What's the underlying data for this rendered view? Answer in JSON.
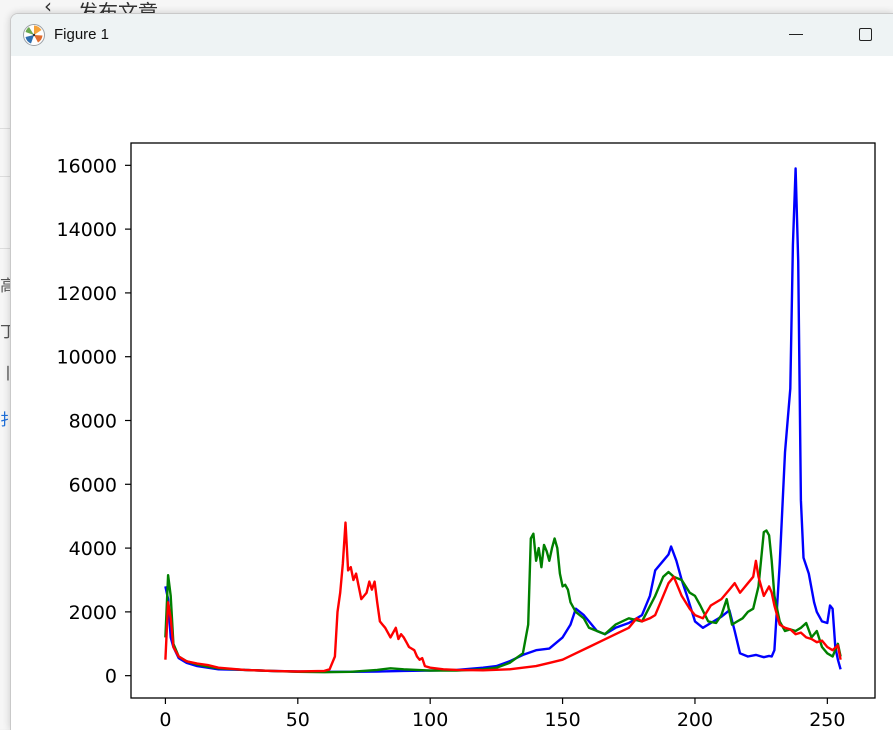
{
  "background": {
    "header_title": "发布文章",
    "back_glyph": "‹",
    "fragments": [
      "高",
      "丁",
      "丨",
      "扌"
    ]
  },
  "window": {
    "title": "Figure 1",
    "icon": "matplotlib-icon",
    "controls": {
      "minimize": "minimize-icon",
      "maximize": "maximize-icon"
    }
  },
  "chart_data": {
    "type": "line",
    "title": "",
    "xlabel": "",
    "ylabel": "",
    "xlim": [
      -13,
      268
    ],
    "ylim": [
      -700,
      16700
    ],
    "xticks": [
      0,
      50,
      100,
      150,
      200,
      250
    ],
    "yticks": [
      0,
      2000,
      4000,
      6000,
      8000,
      10000,
      12000,
      14000,
      16000
    ],
    "grid": false,
    "legend": "none",
    "series": [
      {
        "color": "#0000ff",
        "x": [
          0,
          1,
          2,
          3,
          5,
          8,
          12,
          16,
          20,
          30,
          40,
          50,
          60,
          70,
          80,
          90,
          100,
          110,
          120,
          125,
          130,
          135,
          140,
          145,
          150,
          153,
          155,
          158,
          160,
          163,
          166,
          170,
          175,
          180,
          183,
          185,
          188,
          190,
          191,
          193,
          195,
          197,
          200,
          203,
          206,
          210,
          213,
          215,
          217,
          220,
          223,
          226,
          228,
          229,
          230,
          232,
          234,
          236,
          237,
          238,
          239,
          240,
          241,
          243,
          245,
          246,
          248,
          250,
          251,
          252,
          253,
          254,
          255
        ],
        "y": [
          2800,
          2400,
          1200,
          900,
          550,
          400,
          300,
          250,
          200,
          180,
          150,
          130,
          120,
          120,
          130,
          150,
          160,
          180,
          250,
          300,
          450,
          650,
          800,
          850,
          1200,
          1600,
          2100,
          1900,
          1700,
          1400,
          1300,
          1500,
          1650,
          1900,
          2500,
          3300,
          3600,
          3800,
          4050,
          3600,
          3000,
          2500,
          1700,
          1500,
          1650,
          1850,
          2050,
          1400,
          700,
          600,
          650,
          580,
          620,
          600,
          800,
          3500,
          7000,
          9000,
          13500,
          15900,
          13000,
          5500,
          3700,
          3200,
          2300,
          2000,
          1700,
          1650,
          2200,
          2100,
          900,
          500,
          200
        ]
      },
      {
        "color": "#008000",
        "x": [
          0,
          1,
          2,
          3,
          5,
          8,
          12,
          16,
          20,
          30,
          40,
          50,
          60,
          70,
          80,
          85,
          90,
          95,
          100,
          110,
          120,
          125,
          130,
          135,
          137,
          138,
          139,
          140,
          141,
          142,
          143,
          144,
          145,
          146,
          147,
          148,
          149,
          150,
          151,
          152,
          153,
          155,
          158,
          160,
          163,
          166,
          170,
          175,
          180,
          185,
          188,
          190,
          192,
          195,
          198,
          200,
          202,
          205,
          208,
          210,
          212,
          214,
          216,
          218,
          220,
          222,
          224,
          226,
          227,
          228,
          229,
          230,
          232,
          234,
          236,
          238,
          240,
          242,
          244,
          246,
          248,
          250,
          252,
          254,
          255
        ],
        "y": [
          1200,
          3150,
          2500,
          1000,
          600,
          450,
          350,
          280,
          230,
          180,
          150,
          120,
          110,
          120,
          180,
          230,
          200,
          180,
          160,
          160,
          200,
          250,
          400,
          700,
          1600,
          4300,
          4450,
          3600,
          4000,
          3400,
          4100,
          3900,
          3600,
          4000,
          4300,
          4000,
          3200,
          2800,
          2850,
          2700,
          2300,
          2000,
          1800,
          1500,
          1400,
          1300,
          1600,
          1800,
          1700,
          2500,
          3100,
          3250,
          3100,
          3000,
          2600,
          2500,
          2200,
          1700,
          1650,
          1900,
          2400,
          1600,
          1700,
          1800,
          2000,
          2100,
          2800,
          4500,
          4550,
          4400,
          3600,
          2500,
          1700,
          1400,
          1450,
          1400,
          1500,
          1650,
          1200,
          1400,
          900,
          700,
          600,
          1000,
          600
        ]
      },
      {
        "color": "#ff0000",
        "x": [
          0,
          1,
          2,
          3,
          5,
          8,
          12,
          16,
          20,
          30,
          40,
          50,
          60,
          62,
          64,
          65,
          66,
          67,
          68,
          69,
          70,
          71,
          72,
          73,
          74,
          75,
          76,
          77,
          78,
          79,
          80,
          81,
          82,
          83,
          85,
          87,
          88,
          89,
          90,
          91,
          92,
          93,
          94,
          95,
          96,
          97,
          98,
          100,
          105,
          110,
          120,
          130,
          140,
          145,
          150,
          155,
          160,
          165,
          170,
          175,
          178,
          180,
          183,
          185,
          188,
          190,
          192,
          195,
          198,
          200,
          203,
          206,
          210,
          213,
          215,
          217,
          218,
          220,
          222,
          223,
          224,
          226,
          228,
          229,
          230,
          232,
          234,
          236,
          238,
          240,
          242,
          244,
          246,
          248,
          250,
          252,
          254,
          255
        ],
        "y": [
          500,
          2300,
          1800,
          900,
          600,
          450,
          380,
          330,
          250,
          180,
          150,
          130,
          150,
          200,
          600,
          2000,
          2600,
          3500,
          4800,
          3300,
          3400,
          3000,
          3200,
          2800,
          2400,
          2500,
          2600,
          2950,
          2700,
          2950,
          2300,
          1700,
          1600,
          1500,
          1200,
          1500,
          1150,
          1300,
          1200,
          1050,
          900,
          850,
          800,
          600,
          500,
          550,
          300,
          250,
          200,
          180,
          170,
          200,
          300,
          400,
          500,
          700,
          900,
          1100,
          1300,
          1500,
          1800,
          1700,
          1800,
          1900,
          2500,
          2900,
          3100,
          2500,
          2100,
          1900,
          1800,
          2200,
          2400,
          2700,
          2900,
          2600,
          2700,
          2900,
          3100,
          3600,
          3100,
          2500,
          2800,
          2600,
          2200,
          1600,
          1500,
          1450,
          1300,
          1350,
          1200,
          1150,
          1050,
          1100,
          900,
          800,
          950,
          500
        ]
      }
    ]
  }
}
